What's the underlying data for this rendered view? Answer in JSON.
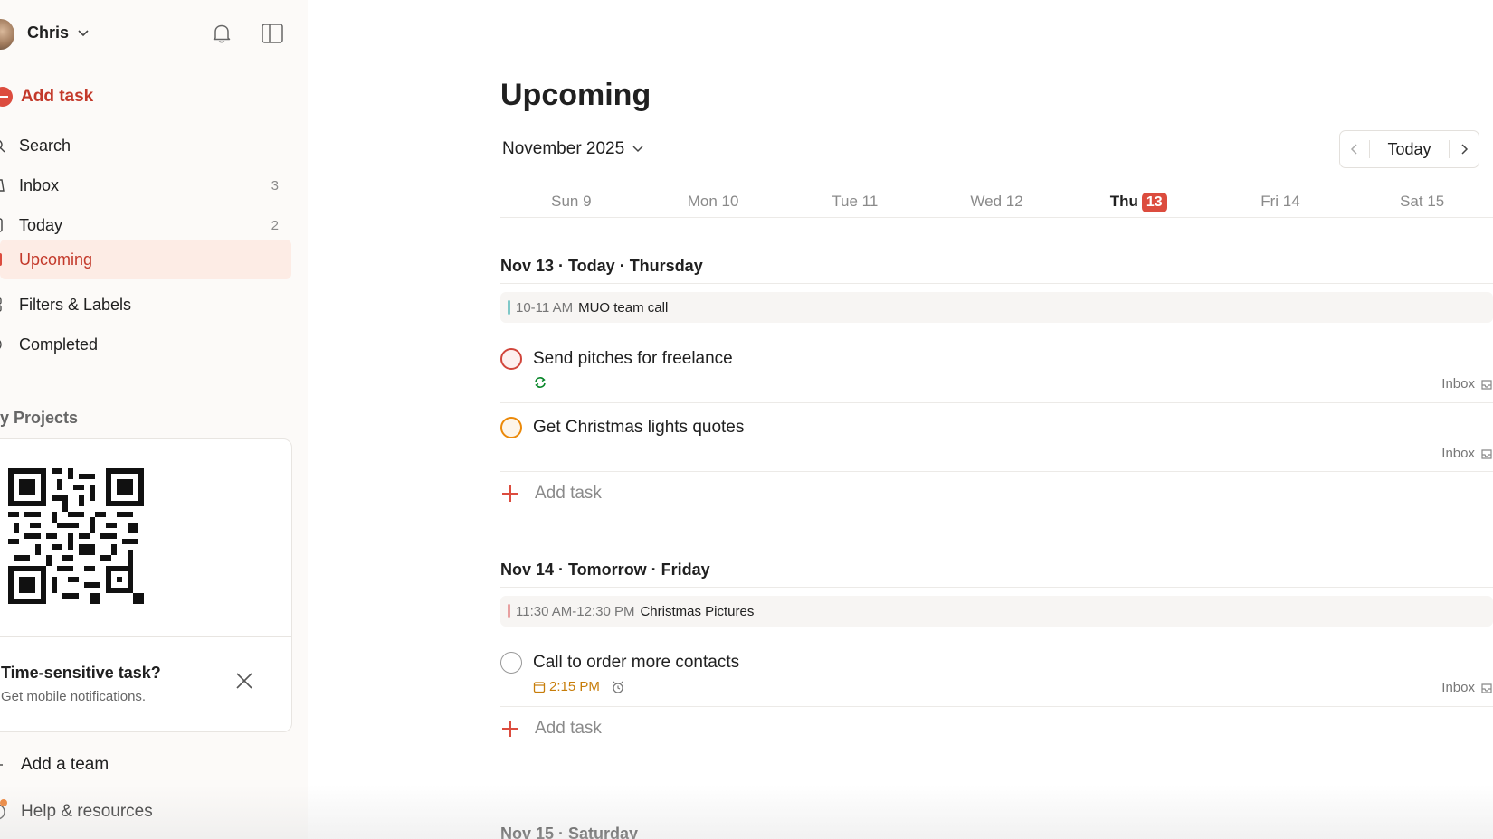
{
  "user": {
    "name": "Chris"
  },
  "sidebar": {
    "add_task": "Add task",
    "nav": [
      {
        "label": "Search",
        "count": ""
      },
      {
        "label": "Inbox",
        "count": "3"
      },
      {
        "label": "Today",
        "count": "2"
      },
      {
        "label": "Upcoming",
        "count": "",
        "active": true
      },
      {
        "label": "Filters & Labels",
        "count": ""
      },
      {
        "label": "Completed",
        "count": ""
      }
    ],
    "projects_heading": "y Projects",
    "promo": {
      "title": "Time-sensitive task?",
      "subtitle": "Get mobile notifications."
    },
    "add_team": "Add a team",
    "help": "Help & resources"
  },
  "main": {
    "title": "Upcoming",
    "month": "November 2025",
    "today_button": "Today",
    "week": [
      {
        "label": "Sun 9"
      },
      {
        "label": "Mon 10"
      },
      {
        "label": "Tue 11"
      },
      {
        "label": "Wed 12"
      },
      {
        "label": "Thu",
        "badge": "13",
        "today": true
      },
      {
        "label": "Fri 14"
      },
      {
        "label": "Sat 15"
      }
    ],
    "sections": [
      {
        "header": "Nov 13 · Today · Thursday",
        "event": {
          "time": "10-11 AM",
          "title": "MUO team call",
          "color": "#7fc8c8"
        },
        "tasks": [
          {
            "title": "Send pitches for freelance",
            "project": "Inbox",
            "priority_color": "#d1453b",
            "recurring": true
          },
          {
            "title": "Get Christmas lights quotes",
            "project": "Inbox",
            "priority_color": "#eb8909"
          }
        ],
        "add_task": "Add task"
      },
      {
        "header": "Nov 14 · Tomorrow · Friday",
        "event": {
          "time": "11:30 AM-12:30 PM",
          "title": "Christmas Pictures",
          "color": "#e8a0a0"
        },
        "tasks": [
          {
            "title": "Call to order more contacts",
            "project": "Inbox",
            "priority_color": "#999999",
            "due": "2:15 PM",
            "due_color": "#c77d0a"
          }
        ],
        "add_task": "Add task"
      },
      {
        "header": "Nov 15 · Saturday"
      }
    ]
  },
  "colors": {
    "accent": "#dc4c3e",
    "active_bg": "#fdece5"
  }
}
